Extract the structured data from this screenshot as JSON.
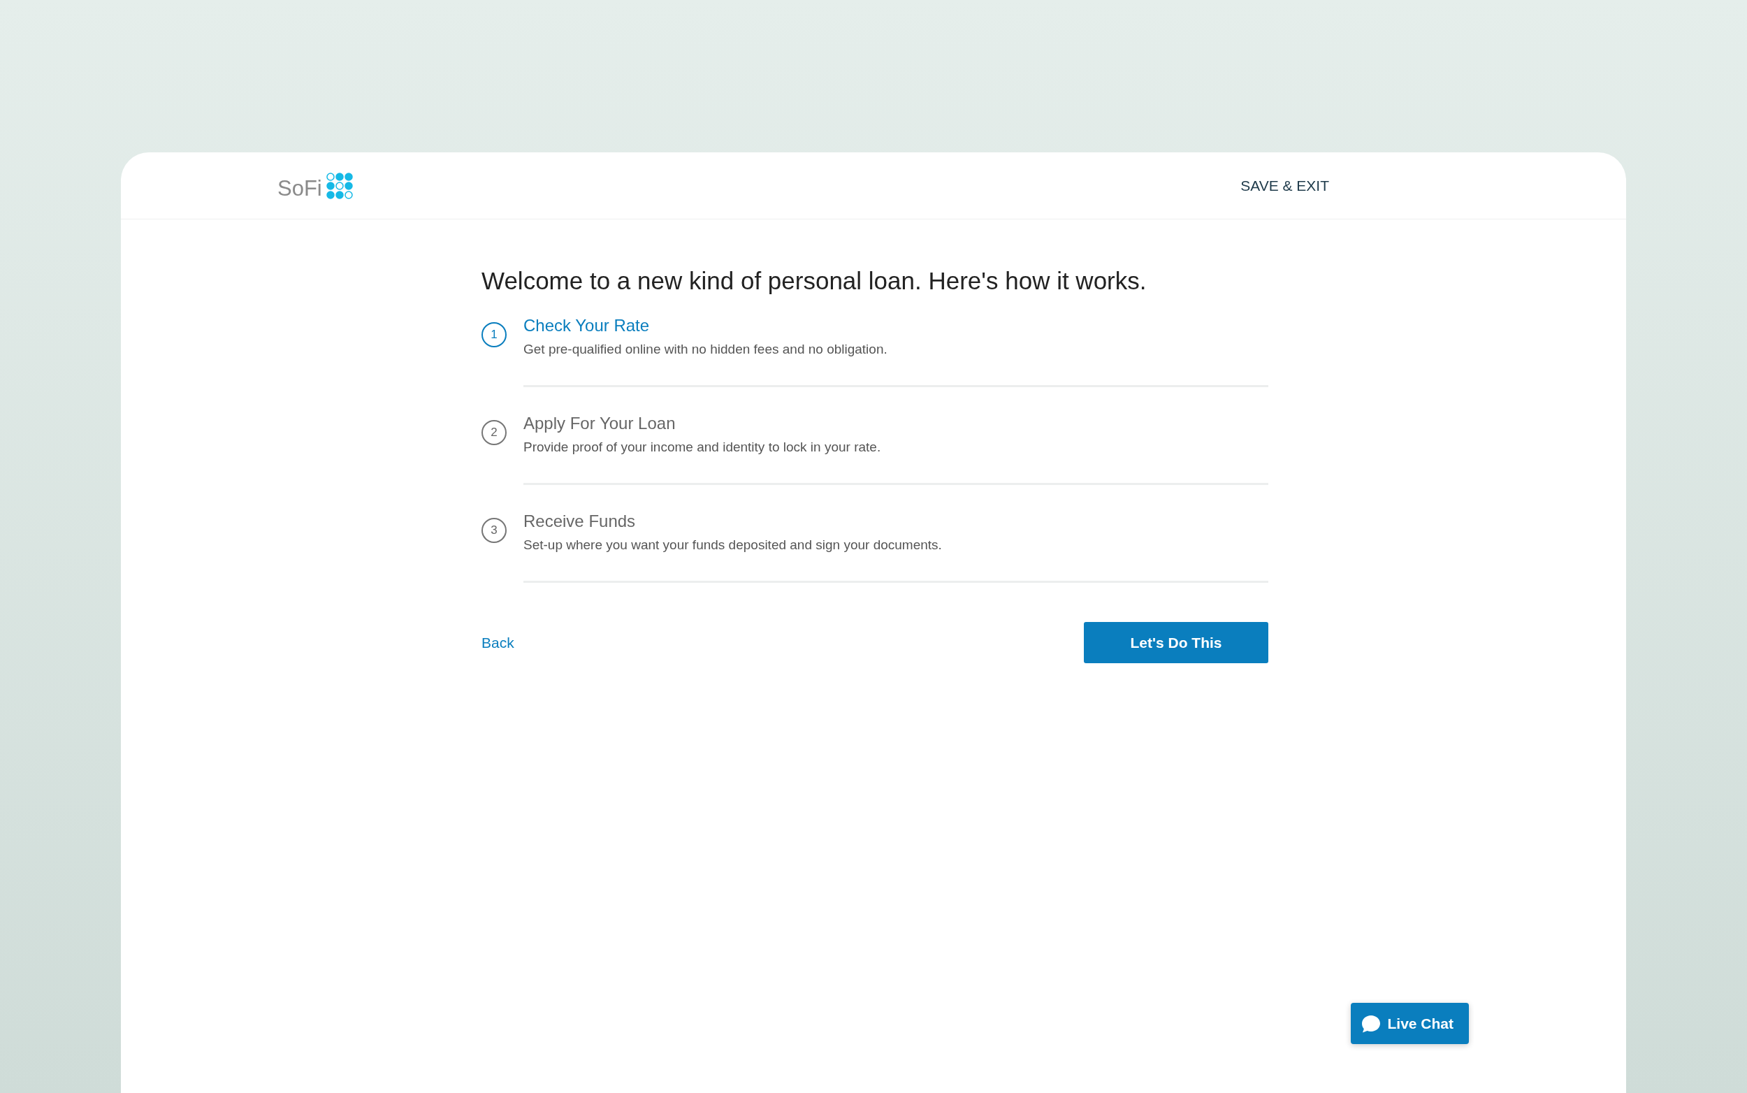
{
  "header": {
    "logo_text": "SoFi",
    "save_exit": "SAVE & EXIT"
  },
  "title": "Welcome to a new kind of personal loan.  Here's how it works.",
  "steps": [
    {
      "number": "1",
      "title": "Check Your Rate",
      "description": "Get pre-qualified online with no hidden fees and no obligation.",
      "selected": true
    },
    {
      "number": "2",
      "title": "Apply For Your Loan",
      "description": "Provide proof of your income and identity to lock in your rate.",
      "selected": false
    },
    {
      "number": "3",
      "title": "Receive Funds",
      "description": "Set-up where you want your funds deposited and sign your documents.",
      "selected": false
    }
  ],
  "back_link": "Back",
  "primary_button": "Let's Do This",
  "live_chat": "Live Chat"
}
